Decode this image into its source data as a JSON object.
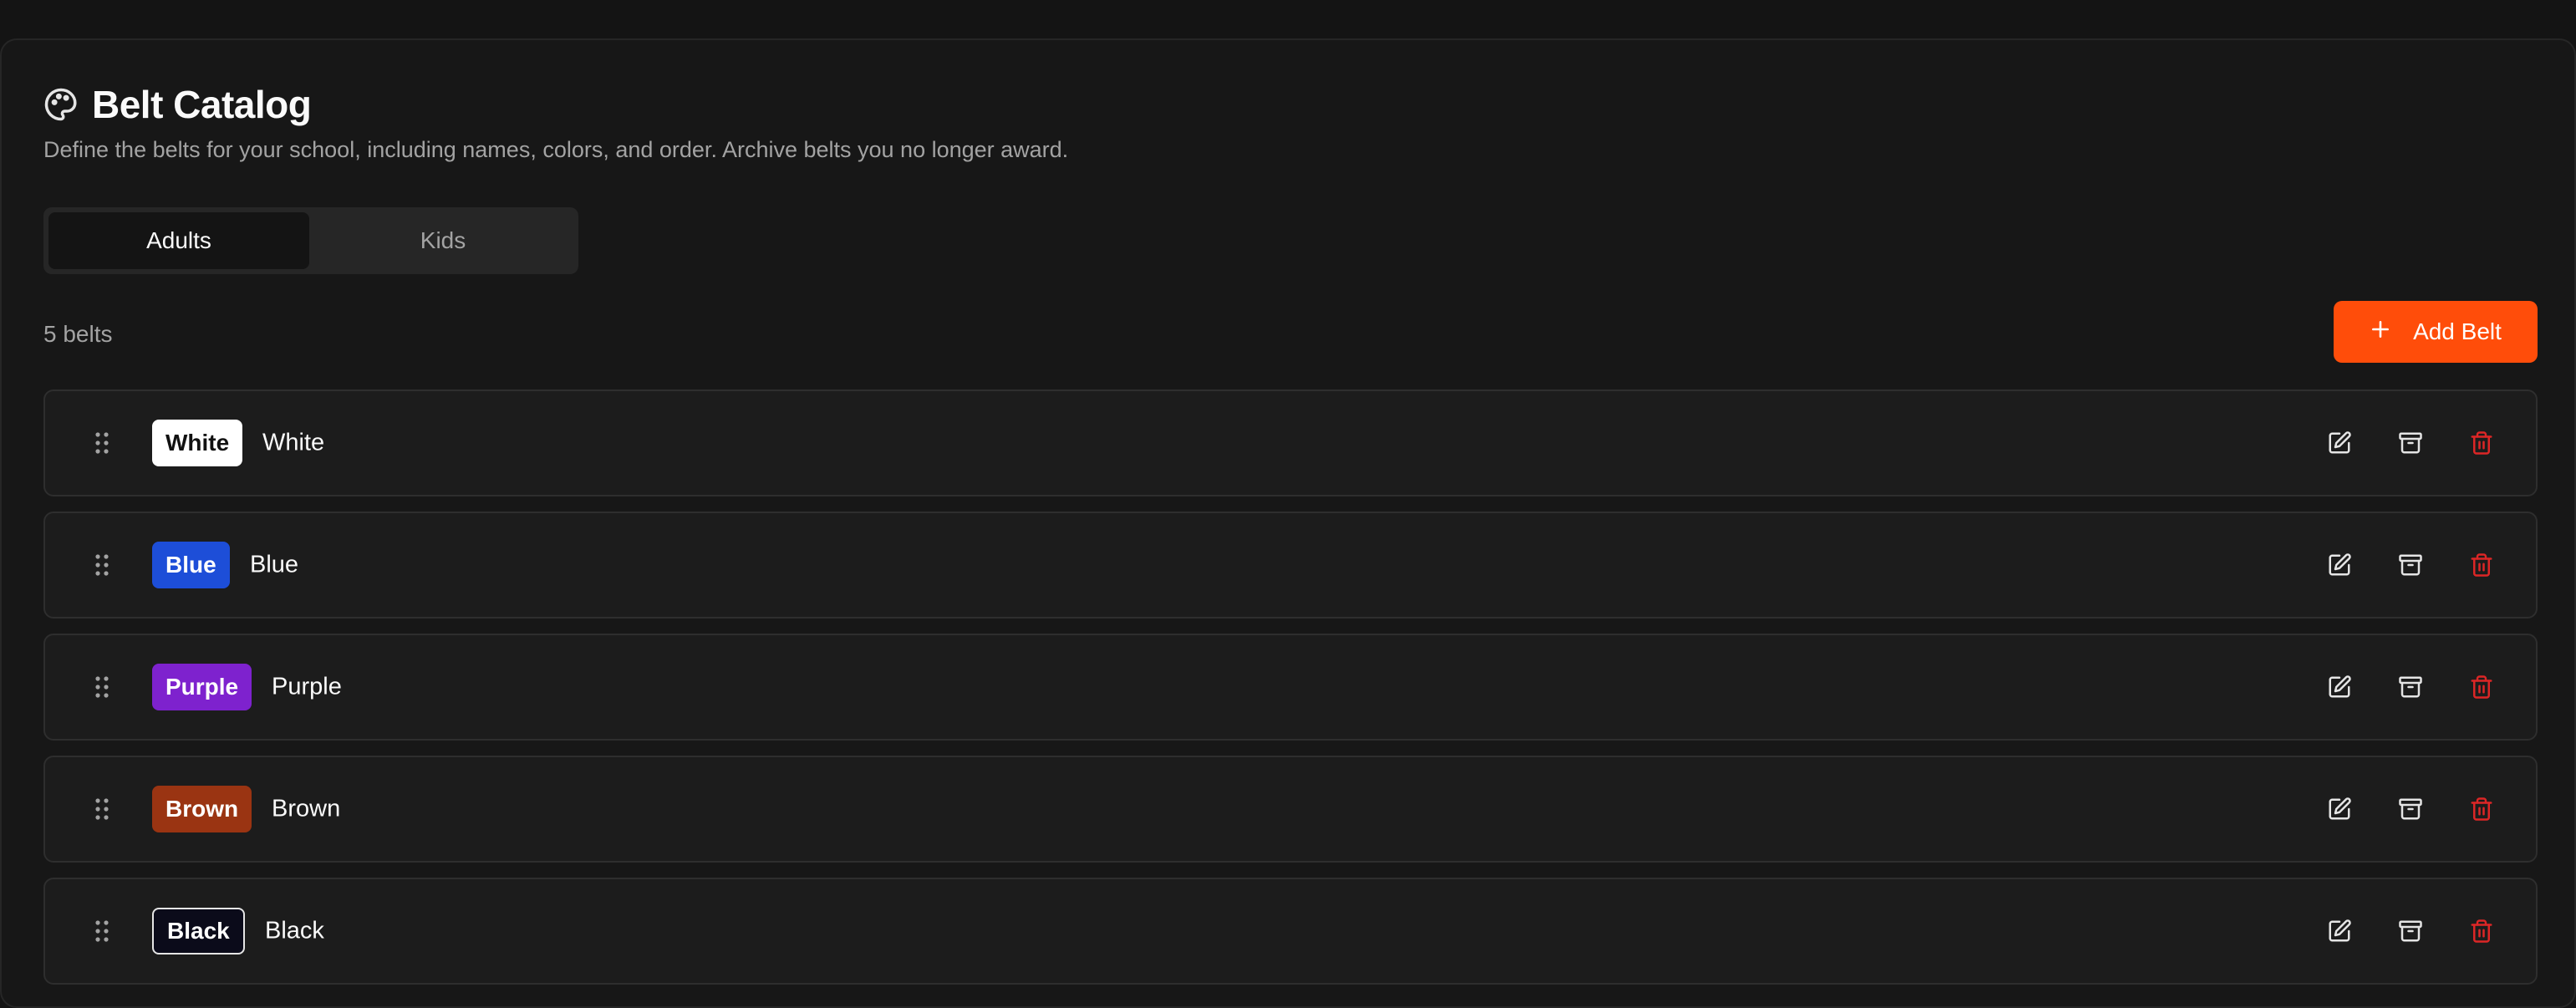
{
  "header": {
    "title": "Belt Catalog",
    "subtitle": "Define the belts for your school, including names, colors, and order. Archive belts you no longer award."
  },
  "tabs": [
    {
      "label": "Adults",
      "active": true
    },
    {
      "label": "Kids",
      "active": false
    }
  ],
  "count_label": "5 belts",
  "add_button": {
    "label": "Add Belt",
    "icon": "plus-icon"
  },
  "colors": {
    "accent": "#ff4d0a",
    "delete": "#dc2626"
  },
  "belts": [
    {
      "chip": "White",
      "name": "White",
      "chip_bg": "#ffffff",
      "chip_fg": "#111111"
    },
    {
      "chip": "Blue",
      "name": "Blue",
      "chip_bg": "#1d4ed8",
      "chip_fg": "#ffffff"
    },
    {
      "chip": "Purple",
      "name": "Purple",
      "chip_bg": "#7e22ce",
      "chip_fg": "#ffffff"
    },
    {
      "chip": "Brown",
      "name": "Brown",
      "chip_bg": "#9a3412",
      "chip_fg": "#ffffff"
    },
    {
      "chip": "Black",
      "name": "Black",
      "chip_bg": "#0b0b1a",
      "chip_fg": "#ffffff"
    }
  ]
}
